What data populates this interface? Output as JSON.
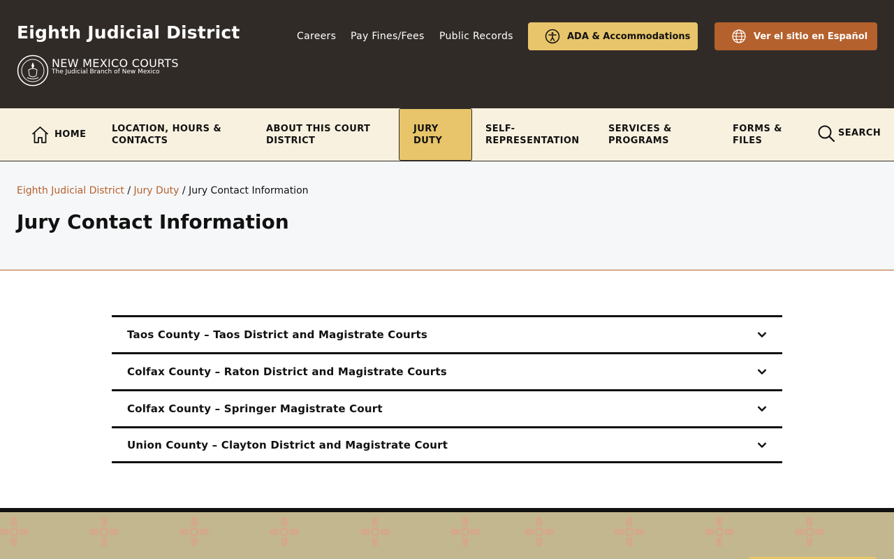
{
  "header": {
    "site_title": "Eighth Judicial District",
    "logo_main": "NEW MEXICO COURTS",
    "logo_sub": "The Judicial Branch of New Mexico",
    "links": [
      "Careers",
      "Pay Fines/Fees",
      "Public Records"
    ],
    "ada_label": "ADA & Accommodations",
    "spanish_label": "Ver el sitio en Español"
  },
  "nav": {
    "items": [
      {
        "line1": "HOME",
        "line2": ""
      },
      {
        "line1": "LOCATION, HOURS &",
        "line2": "CONTACTS"
      },
      {
        "line1": "ABOUT THIS COURT",
        "line2": "DISTRICT"
      },
      {
        "line1": "JURY",
        "line2": "DUTY"
      },
      {
        "line1": "SELF-",
        "line2": "REPRESENTATION"
      },
      {
        "line1": "SERVICES &",
        "line2": "PROGRAMS"
      },
      {
        "line1": "FORMS &",
        "line2": "FILES"
      },
      {
        "line1": "SEARCH",
        "line2": ""
      }
    ],
    "active_index": 3
  },
  "breadcrumb": {
    "items": [
      "Eighth Judicial District",
      "Jury Duty"
    ],
    "current": "Jury Contact Information",
    "separator": "/"
  },
  "page_title": "Jury Contact Information",
  "accordion": {
    "items": [
      "Taos County – Taos District and Magistrate Courts",
      "Colfax County – Raton District and Magistrate Courts",
      "Colfax County – Springer Magistrate Court",
      "Union County – Clayton District and Magistrate Court"
    ]
  },
  "colors": {
    "header_bg": "#312b27",
    "nav_bg": "#f8f1df",
    "accent_gold": "#e8c56a",
    "accent_rust": "#b5612d",
    "footer_pattern": "#c3b78f"
  },
  "icons": {
    "home": "home-icon",
    "search": "search-icon",
    "ada": "accessibility-icon",
    "language": "globe-icon",
    "accordion": "chevron-down-icon",
    "footer": "zia-sun-icon"
  }
}
